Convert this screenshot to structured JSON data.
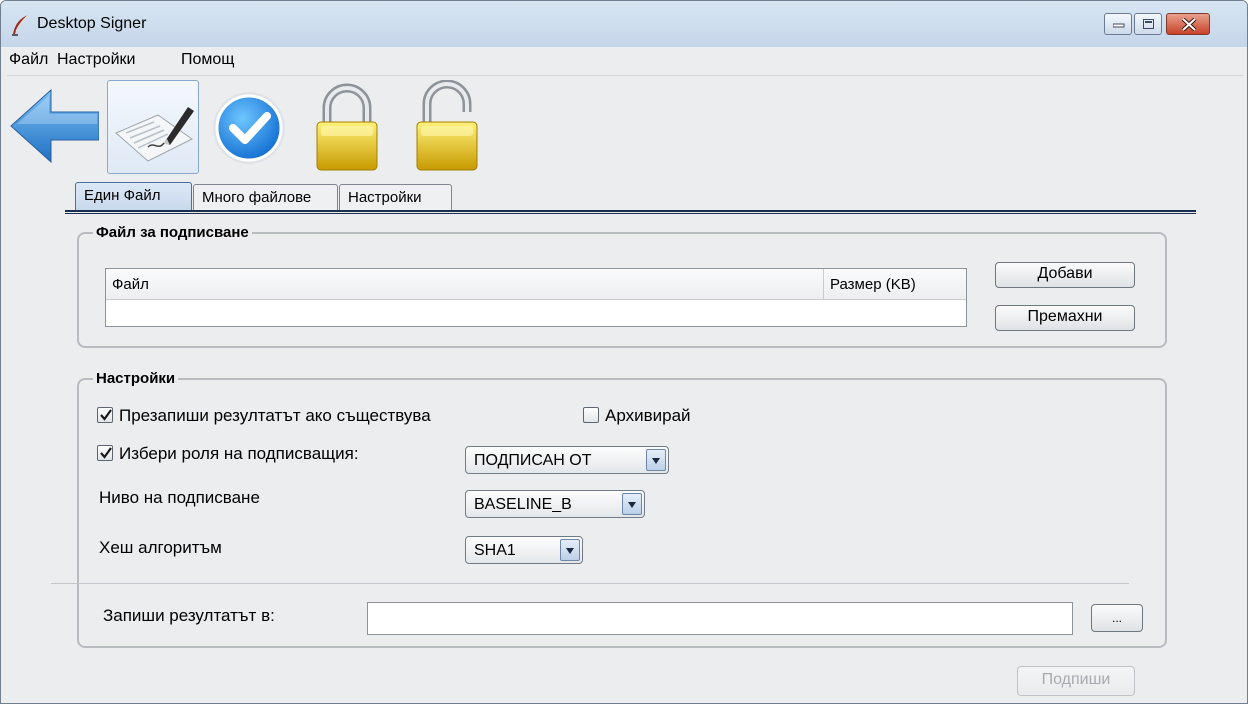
{
  "window": {
    "title": "Desktop Signer"
  },
  "menu": [
    "Файл",
    "Настройки",
    "Помощ"
  ],
  "toolbar": {
    "buttons": [
      {
        "icon": "back-arrow-icon"
      },
      {
        "icon": "sign-document-icon",
        "selected": true
      },
      {
        "icon": "verify-check-icon"
      },
      {
        "icon": "lock-closed-icon"
      },
      {
        "icon": "lock-open-icon"
      }
    ]
  },
  "tabs": [
    {
      "label": "Един Файл",
      "active": true
    },
    {
      "label": "Много файлове",
      "active": false
    },
    {
      "label": "Настройки",
      "active": false
    }
  ],
  "file_group": {
    "title": "Файл за подписване",
    "columns": [
      "Файл",
      "Размер (KB)"
    ],
    "rows": [],
    "add_button": "Добави",
    "remove_button": "Премахни"
  },
  "settings_group": {
    "title": "Настройки",
    "overwrite": {
      "label": "Презапиши резултатът ако съществува",
      "checked": true
    },
    "archive": {
      "label": "Архивирай",
      "checked": false
    },
    "role": {
      "label": "Избери роля на подписващия:",
      "checked": true,
      "value": "ПОДПИСАН ОТ"
    },
    "level": {
      "label": "Ниво на подписване",
      "value": "BASELINE_B"
    },
    "hash": {
      "label": "Хеш алгоритъм",
      "value": "SHA1"
    },
    "output": {
      "label": "Запиши резултатът в:",
      "value": "",
      "browse_label": "..."
    }
  },
  "sign_button": {
    "label": "Подпиши",
    "enabled": false
  }
}
